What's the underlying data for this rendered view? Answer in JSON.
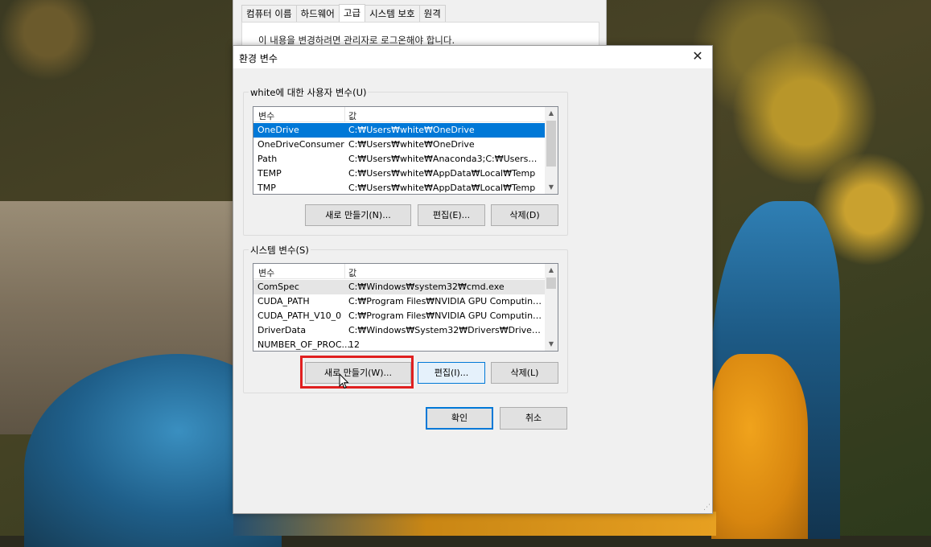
{
  "background_window": {
    "tabs": [
      "컴퓨터 이름",
      "하드웨어",
      "고급",
      "시스템 보호",
      "원격"
    ],
    "active_tab": 2,
    "notice": "이 내용을 변경하려면 관리자로 로그온해야 합니다."
  },
  "dialog": {
    "title": "환경 변수",
    "close_glyph": "✕",
    "user_vars": {
      "legend": "white에 대한 사용자 변수(U)",
      "col_name": "변수",
      "col_value": "값",
      "rows": [
        {
          "name": "OneDrive",
          "value": "C:₩Users₩white₩OneDrive"
        },
        {
          "name": "OneDriveConsumer",
          "value": "C:₩Users₩white₩OneDrive"
        },
        {
          "name": "Path",
          "value": "C:₩Users₩white₩Anaconda3;C:₩Users₩white..."
        },
        {
          "name": "TEMP",
          "value": "C:₩Users₩white₩AppData₩Local₩Temp"
        },
        {
          "name": "TMP",
          "value": "C:₩Users₩white₩AppData₩Local₩Temp"
        }
      ],
      "selected_index": 0,
      "new_label": "새로 만들기(N)...",
      "edit_label": "편집(E)...",
      "delete_label": "삭제(D)"
    },
    "system_vars": {
      "legend": "시스템 변수(S)",
      "col_name": "변수",
      "col_value": "값",
      "rows": [
        {
          "name": "ComSpec",
          "value": "C:₩Windows₩system32₩cmd.exe"
        },
        {
          "name": "CUDA_PATH",
          "value": "C:₩Program Files₩NVIDIA GPU Computing T..."
        },
        {
          "name": "CUDA_PATH_V10_0",
          "value": "C:₩Program Files₩NVIDIA GPU Computing T..."
        },
        {
          "name": "DriverData",
          "value": "C:₩Windows₩System32₩Drivers₩DriverData"
        },
        {
          "name": "NUMBER_OF_PROC...",
          "value": "12"
        }
      ],
      "highlighted_index": 0,
      "new_label": "새로 만들기(W)...",
      "edit_label": "편집(I)...",
      "delete_label": "삭제(L)"
    },
    "ok_label": "확인",
    "cancel_label": "취소"
  },
  "colors": {
    "selection": "#0078d7",
    "annotation_box": "#e02020"
  }
}
